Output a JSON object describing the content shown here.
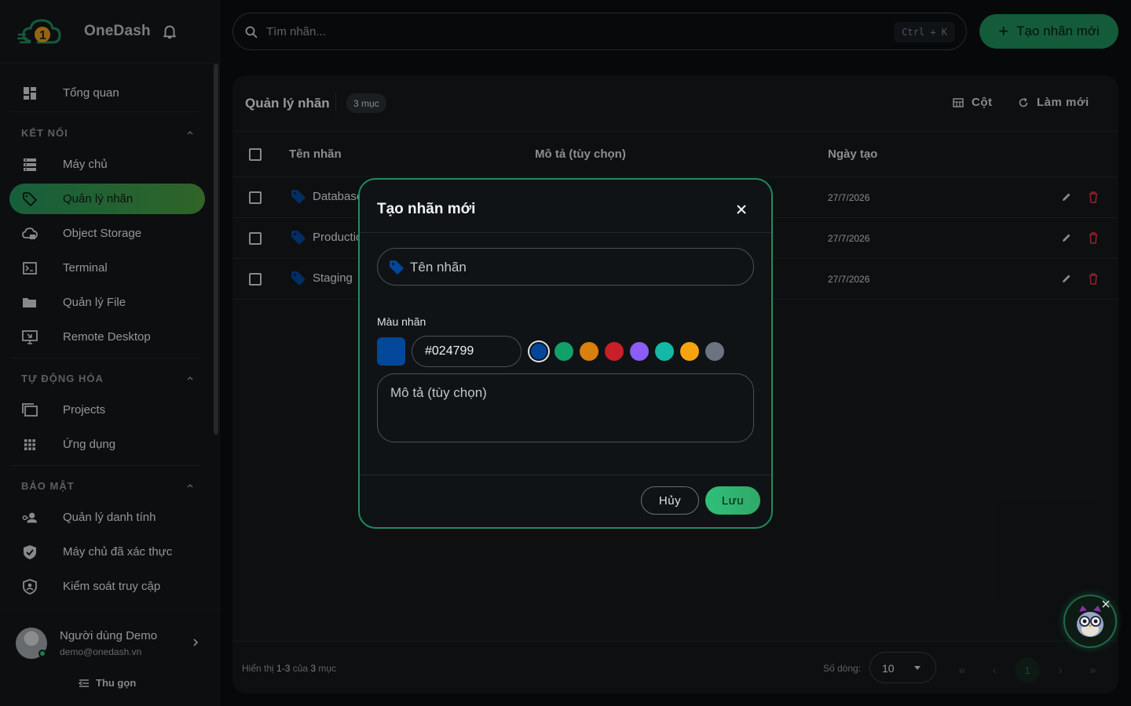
{
  "brand": {
    "name": "OneDash"
  },
  "sidebar": {
    "items": [
      {
        "label": "Tổng quan",
        "icon": "dashboard-icon"
      },
      {
        "label": "Máy chủ",
        "icon": "server-icon"
      },
      {
        "label": "Quản lý nhãn",
        "icon": "tag-icon",
        "active": true
      },
      {
        "label": "Object Storage",
        "icon": "cloud-icon"
      },
      {
        "label": "Terminal",
        "icon": "terminal-icon"
      },
      {
        "label": "Quản lý File",
        "icon": "folder-icon"
      },
      {
        "label": "Remote Desktop",
        "icon": "remote-desktop-icon"
      },
      {
        "label": "Projects",
        "icon": "projects-icon"
      },
      {
        "label": "Ứng dụng",
        "icon": "apps-grid-icon"
      },
      {
        "label": "Quản lý danh tính",
        "icon": "identity-icon"
      },
      {
        "label": "Máy chủ đã xác thực",
        "icon": "shield-check-icon"
      },
      {
        "label": "Kiểm soát truy cập",
        "icon": "access-shield-icon"
      }
    ],
    "sections": {
      "connect": "KẾT NỐI",
      "automation": "TỰ ĐỘNG HÓA",
      "security": "BẢO MẬT"
    },
    "user": {
      "name": "Người dùng Demo",
      "email": "demo@onedash.vn"
    },
    "collapse_label": "Thu gọn"
  },
  "search": {
    "placeholder": "Tìm nhãn...",
    "shortcut": "Ctrl + K"
  },
  "toolbar": {
    "new_label": "Tạo nhãn mới"
  },
  "card": {
    "title": "Quản lý nhãn",
    "count_badge": "3 mục",
    "columns_btn": "Cột",
    "refresh_btn": "Làm mới",
    "headers": {
      "name": "Tên nhãn",
      "description": "Mô tả (tùy chọn)",
      "created": "Ngày tạo"
    },
    "rows": [
      {
        "name": "Database",
        "date": "27/7/2026"
      },
      {
        "name": "Production",
        "date": "27/7/2026"
      },
      {
        "name": "Staging",
        "date": "27/7/2026"
      }
    ],
    "footer": {
      "info_prefix": "Hiển thị ",
      "info_range": "1-3",
      "info_mid": " của ",
      "info_total": "3",
      "info_suffix": " mục",
      "rows_label": "Số dòng:",
      "rows_value": "10",
      "current_page": "1"
    }
  },
  "modal": {
    "title": "Tạo nhãn mới",
    "name_placeholder": "Tên nhãn",
    "color_label": "Màu nhãn",
    "color_value": "#024799",
    "palette": [
      "#024799",
      "#12a06a",
      "#d97f0d",
      "#c81f28",
      "#8b5cf6",
      "#14b8a6",
      "#f5a30e",
      "#6b7280"
    ],
    "description_placeholder": "Mô tả (tùy chọn)",
    "cancel_label": "Hủy",
    "save_label": "Lưu"
  },
  "colors": {
    "accent": "#1f8c5a",
    "tag": "#024799",
    "danger": "#e0353f"
  }
}
